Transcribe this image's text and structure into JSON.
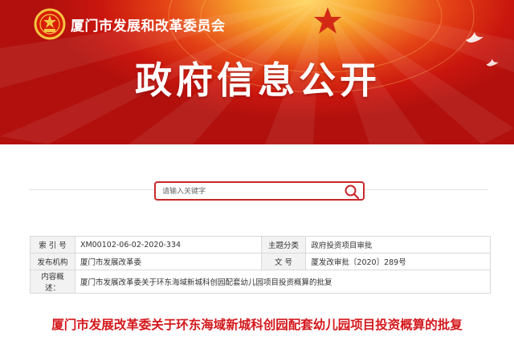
{
  "header": {
    "agency_name": "厦门市发展和改革委员会",
    "section_title": "政府信息公开",
    "colors": {
      "red": "#c9160e",
      "gold": "#f7a22c"
    },
    "icons": [
      "national-emblem-icon",
      "star-icon",
      "dove-icon"
    ]
  },
  "search": {
    "placeholder": "请输入关键字",
    "button_icon": "search-icon",
    "accent": "#c8282a"
  },
  "meta": {
    "index_label": "索 引 号",
    "index_value": "XM00102-06-02-2020-334",
    "category_label": "主题分类",
    "category_value": "政府投资项目审批",
    "issuer_label": "发布机构",
    "issuer_value": "厦门市发展改革委",
    "docno_label": "文 号",
    "docno_value": "厦发改审批〔2020〕289号",
    "summary_label": "内容概述：",
    "summary_value": "厦门市发展改革委关于环东海域新城科创园配套幼儿园项目投资概算的批复"
  },
  "document": {
    "title": "厦门市发展改革委关于环东海域新城科创园配套幼儿园项目投资概算的批复"
  }
}
